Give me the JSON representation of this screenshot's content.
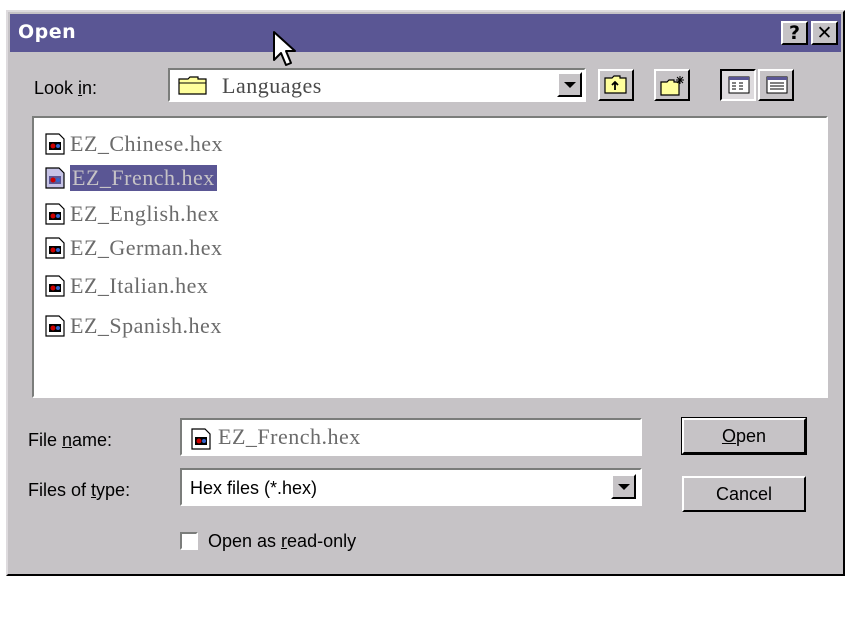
{
  "dialog": {
    "title": "Open",
    "help_glyph": "?",
    "close_glyph": "✕"
  },
  "look_in": {
    "label_pre": "Look ",
    "label_key": "i",
    "label_post": "n:",
    "value": "Languages",
    "icon": "folder-icon"
  },
  "toolbar": {
    "up_icon": "up-folder-icon",
    "new_icon": "new-folder-icon",
    "list_icon": "list-view-icon",
    "details_icon": "details-view-icon"
  },
  "files": [
    {
      "name": "EZ_Chinese.hex",
      "selected": false
    },
    {
      "name": "EZ_French.hex",
      "selected": true
    },
    {
      "name": "EZ_English.hex",
      "selected": false
    },
    {
      "name": "EZ_German.hex",
      "selected": false
    },
    {
      "name": "EZ_Italian.hex",
      "selected": false
    },
    {
      "name": "EZ_Spanish.hex",
      "selected": false
    }
  ],
  "file_name": {
    "label_pre": "File ",
    "label_key": "n",
    "label_post": "ame:",
    "value": "EZ_French.hex"
  },
  "file_type": {
    "label_pre": "Files of ",
    "label_key": "t",
    "label_post": "ype:",
    "value": "Hex files (*.hex)"
  },
  "buttons": {
    "open_key": "O",
    "open_rest": "pen",
    "cancel": "Cancel"
  },
  "read_only": {
    "label_pre": "Open as ",
    "label_key": "r",
    "label_post": "ead-only",
    "checked": false
  },
  "colors": {
    "title_bar": "#5a5694",
    "face": "#c6c3c6",
    "selection": "#5a5694"
  }
}
